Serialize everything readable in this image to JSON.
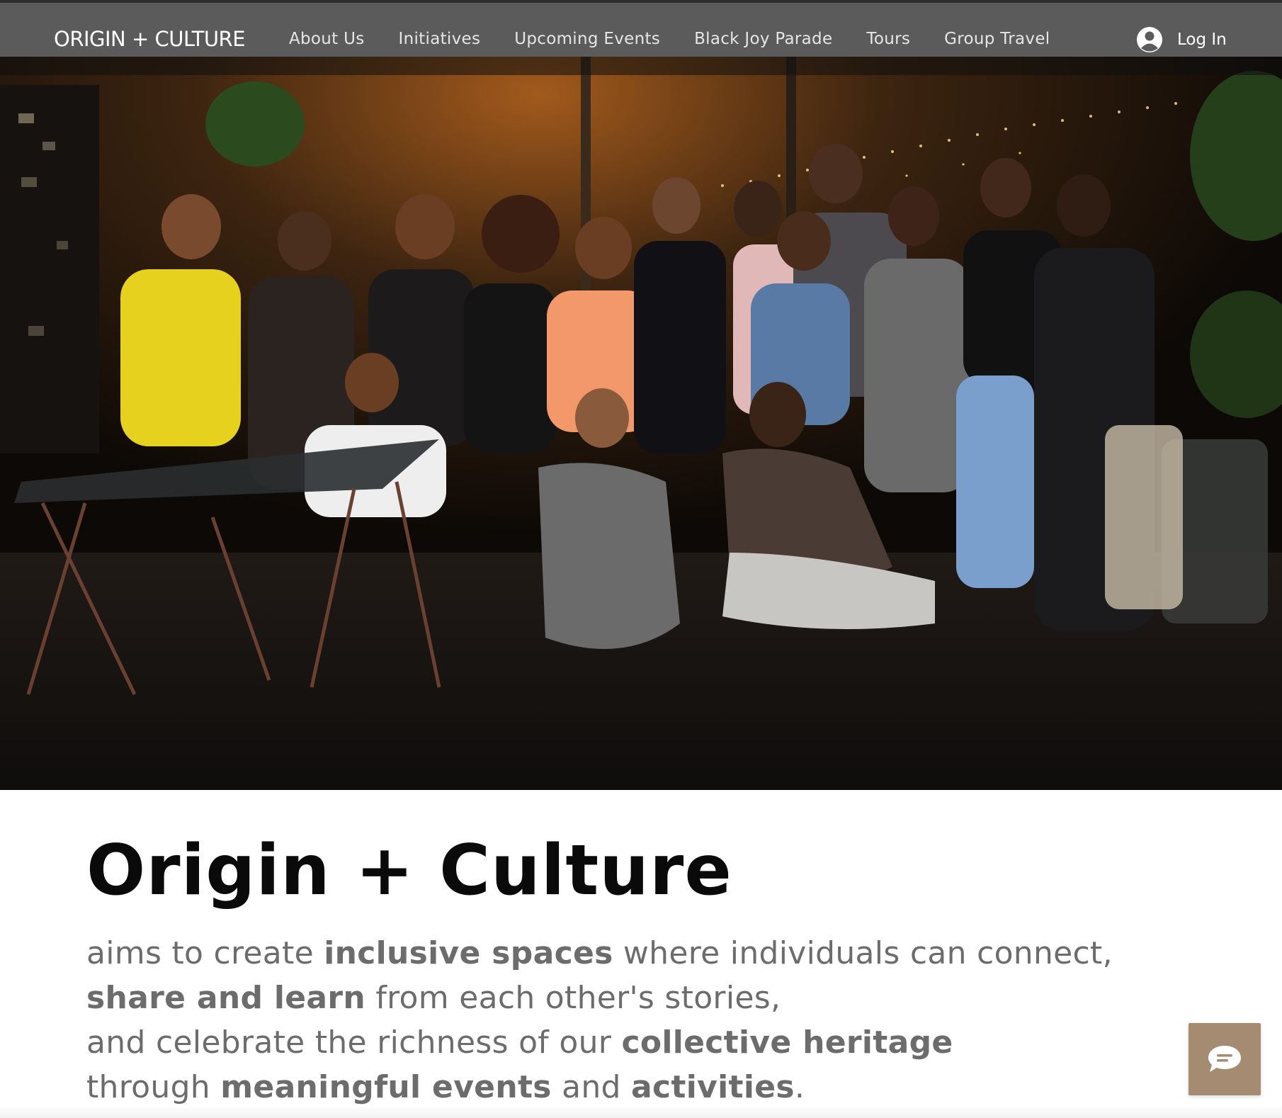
{
  "header": {
    "logo": "ORIGIN + CULTURE",
    "nav": [
      "About Us",
      "Initiatives",
      "Upcoming Events",
      "Black Joy Parade",
      "Tours",
      "Group Travel"
    ],
    "login_label": "Log In"
  },
  "hero": {
    "icon": "group-photo"
  },
  "intro": {
    "title": "Origin + Culture",
    "lines": [
      [
        {
          "text": "aims to create ",
          "bold": false
        },
        {
          "text": "inclusive spaces",
          "bold": true
        },
        {
          "text": " where individuals can connect,",
          "bold": false
        }
      ],
      [
        {
          "text": "share and learn",
          "bold": true
        },
        {
          "text": " from each other's stories,",
          "bold": false
        }
      ],
      [
        {
          "text": "and celebrate the richness of our ",
          "bold": false
        },
        {
          "text": "collective heritage",
          "bold": true
        }
      ],
      [
        {
          "text": "through ",
          "bold": false
        },
        {
          "text": "meaningful events",
          "bold": true
        },
        {
          "text": " and ",
          "bold": false
        },
        {
          "text": "activities",
          "bold": true
        },
        {
          "text": ".",
          "bold": false
        }
      ]
    ]
  },
  "chat": {
    "icon": "chat-bubble-icon"
  },
  "colors": {
    "header_bg": "#5b5b5b",
    "title": "#0a0a0a",
    "body_text": "#6c6c6c",
    "chat_button": "#a48b72"
  }
}
